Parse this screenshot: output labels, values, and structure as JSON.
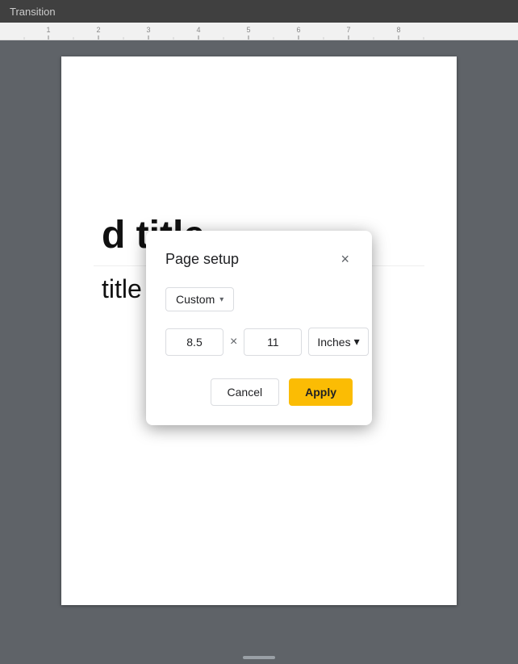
{
  "topbar": {
    "title": "Transition"
  },
  "ruler": {
    "marks": [
      1,
      2,
      3,
      4,
      5,
      6,
      7,
      8
    ]
  },
  "page": {
    "title_text": "d title",
    "subtitle_text": "title"
  },
  "modal": {
    "title": "Page setup",
    "close_label": "×",
    "preset": {
      "label": "Custom",
      "chevron": "▾"
    },
    "width_value": "8.5",
    "height_value": "11",
    "separator": "×",
    "unit": {
      "label": "Inches",
      "chevron": "▾"
    },
    "cancel_label": "Cancel",
    "apply_label": "Apply"
  }
}
